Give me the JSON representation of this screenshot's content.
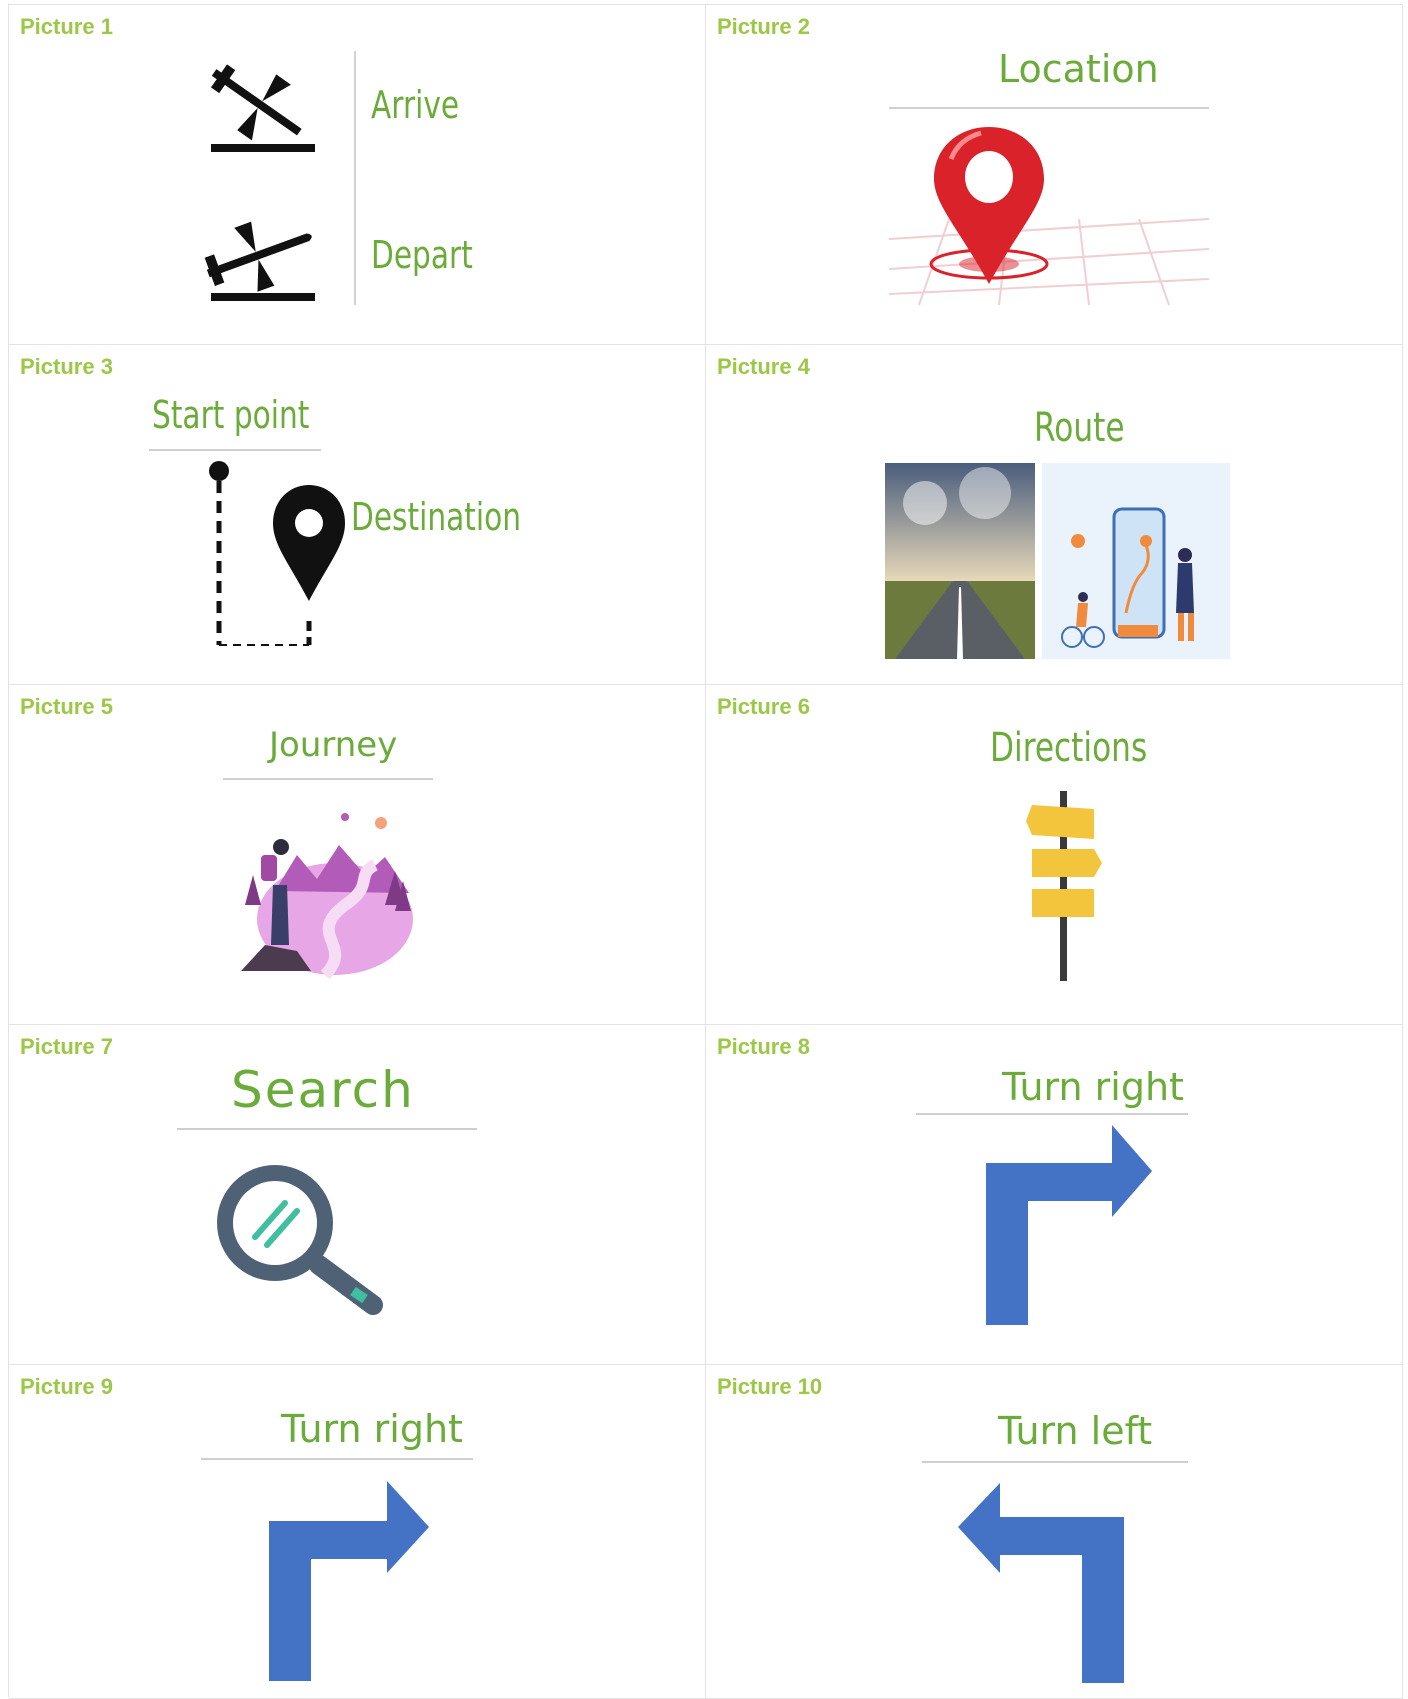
{
  "cells": [
    {
      "label": "Picture 1",
      "words": [
        "Arrive",
        "Depart"
      ]
    },
    {
      "label": "Picture 2",
      "words": [
        "Location"
      ]
    },
    {
      "label": "Picture 3",
      "words": [
        "Start point",
        "Destination"
      ]
    },
    {
      "label": "Picture 4",
      "words": [
        "Route"
      ]
    },
    {
      "label": "Picture 5",
      "words": [
        "Journey"
      ]
    },
    {
      "label": "Picture 6",
      "words": [
        "Directions"
      ]
    },
    {
      "label": "Picture 7",
      "words": [
        "Search"
      ]
    },
    {
      "label": "Picture 8",
      "words": [
        "Turn right"
      ]
    },
    {
      "label": "Picture 9",
      "words": [
        "Turn right"
      ]
    },
    {
      "label": "Picture 10",
      "words": [
        "Turn left"
      ]
    }
  ],
  "colors": {
    "label_green": "#9bc846",
    "handwriting_green": "#6aab3a",
    "arrow_blue": "#4472c4",
    "pin_red": "#d9222a",
    "sign_yellow": "#f2c53d",
    "magnifier_slate": "#4f6275",
    "magnifier_teal": "#3fbfa0"
  },
  "icons": [
    "plane-arrival-icon",
    "plane-departure-icon",
    "map-pin-icon",
    "route-path-icon",
    "road-photo",
    "navigation-app-illustration",
    "journey-illustration",
    "signpost-icon",
    "magnifier-icon",
    "turn-right-arrow-icon",
    "turn-left-arrow-icon"
  ]
}
